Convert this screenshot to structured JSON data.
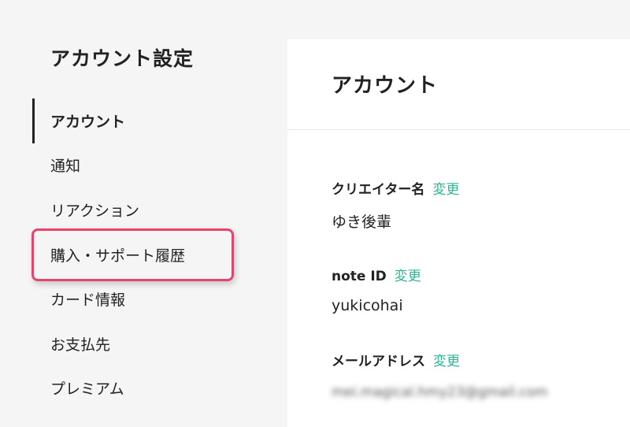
{
  "sidebar": {
    "title": "アカウント設定",
    "items": [
      {
        "label": "アカウント",
        "active": true
      },
      {
        "label": "通知"
      },
      {
        "label": "リアクション"
      },
      {
        "label": "購入・サポート履歴",
        "highlighted": true
      },
      {
        "label": "カード情報"
      },
      {
        "label": "お支払先"
      },
      {
        "label": "プレミアム"
      }
    ]
  },
  "main": {
    "title": "アカウント",
    "fields": [
      {
        "label": "クリエイター名",
        "change": "変更",
        "value": "ゆき後輩"
      },
      {
        "label": "note ID",
        "change": "変更",
        "value": "yukicohai"
      },
      {
        "label": "メールアドレス",
        "change": "変更",
        "value": "mei.magical.hmy23@gmail.com"
      }
    ]
  },
  "colors": {
    "accent_green": "#2cb696",
    "highlight_pink": "#e8436b",
    "background": "#f5f5f5"
  }
}
